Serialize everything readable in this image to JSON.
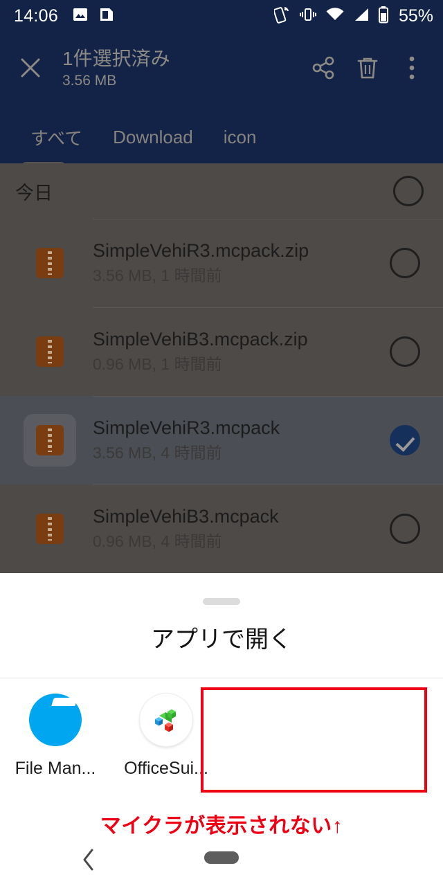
{
  "statusbar": {
    "time": "14:06",
    "battery_percent": "55%",
    "left_icons": [
      "image-icon",
      "clipboard-icon"
    ],
    "right_icons": [
      "nfc-icon",
      "vibrate-icon",
      "wifi-icon",
      "signal-icon",
      "battery-icon"
    ]
  },
  "appbar": {
    "close_icon": "close-icon",
    "title": "1件選択済み",
    "subtitle": "3.56 MB",
    "share_icon": "share-icon",
    "delete_icon": "trash-icon",
    "overflow_icon": "more-vertical-icon",
    "background_color": "#122347",
    "text_color": "#8d8a86"
  },
  "tabs": [
    {
      "label": "すべて",
      "selected": true
    },
    {
      "label": "Download",
      "selected": false
    },
    {
      "label": "icon",
      "selected": false
    }
  ],
  "filelist": {
    "group_header": "今日",
    "group_checkbox_state": "unchecked",
    "rows": [
      {
        "name": "SimpleVehiR3.mcpack.zip",
        "meta": "3.56 MB, 1 時間前",
        "icon": "zip-file-icon",
        "selected": false
      },
      {
        "name": "SimpleVehiB3.mcpack.zip",
        "meta": "0.96 MB, 1 時間前",
        "icon": "zip-file-icon",
        "selected": false
      },
      {
        "name": "SimpleVehiR3.mcpack",
        "meta": "3.56 MB, 4 時間前",
        "icon": "zip-file-icon",
        "selected": true
      },
      {
        "name": "SimpleVehiB3.mcpack",
        "meta": "0.96 MB, 4 時間前",
        "icon": "zip-file-icon",
        "selected": false
      }
    ]
  },
  "sheet": {
    "title": "アプリで開く",
    "grabber": "drag-handle",
    "apps": [
      {
        "label": "File Man...",
        "icon": "file-manager-icon"
      },
      {
        "label": "OfficeSui...",
        "icon": "officesuite-icon"
      }
    ]
  },
  "annotation": {
    "text": "マイクラが表示されない↑",
    "color": "#ee0014",
    "highlight_box": "empty-app-slot-highlight"
  },
  "navbar": {
    "back_icon": "back-chevron-icon",
    "home_pill": "home-pill-icon"
  }
}
